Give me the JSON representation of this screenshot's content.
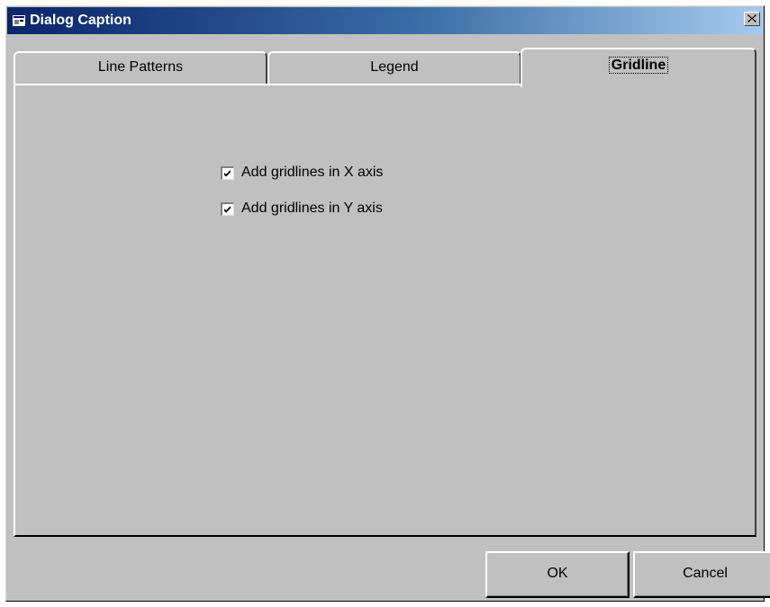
{
  "window": {
    "title": "Dialog Caption",
    "icon": "app-window-icon",
    "close_icon": "close-icon"
  },
  "tabs": [
    {
      "label": "Line Patterns",
      "selected": false
    },
    {
      "label": "Legend",
      "selected": false
    },
    {
      "label": "Gridline",
      "selected": true
    }
  ],
  "gridline_panel": {
    "options": [
      {
        "label": "Add gridlines in X axis",
        "checked": true
      },
      {
        "label": "Add gridlines in Y axis",
        "checked": true
      }
    ]
  },
  "buttons": {
    "ok_label": "OK",
    "cancel_label": "Cancel"
  },
  "colors": {
    "title_gradient_start": "#0a246a",
    "title_gradient_end": "#a6caf0",
    "face": "#c0c0c0"
  }
}
